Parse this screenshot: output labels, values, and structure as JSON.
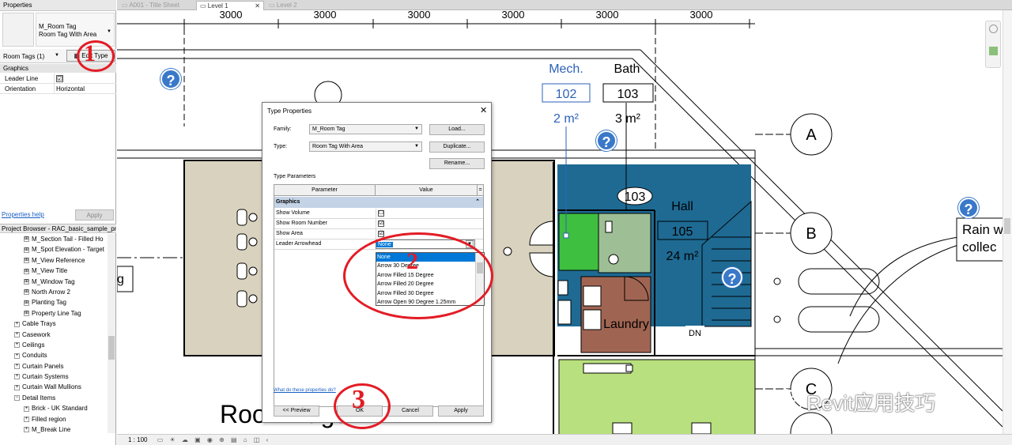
{
  "properties_palette": {
    "title": "Properties",
    "type_family": "M_Room Tag",
    "type_name": "Room Tag With Area",
    "instance_selector": "Room Tags (1)",
    "edit_type_label": "Edit Type",
    "group_graphics": "Graphics",
    "rows": [
      {
        "label": "Leader Line",
        "value": "☑"
      },
      {
        "label": "Orientation",
        "value": "Horizontal"
      }
    ],
    "help_link": "Properties help",
    "apply_label": "Apply"
  },
  "project_browser": {
    "title": "Project Browser - RAC_basic_sample_project.rvt",
    "items": [
      {
        "label": "M_Section Tail - Filled Ho",
        "level": 2,
        "expander": "⊞"
      },
      {
        "label": "M_Spot Elevation - Target",
        "level": 2,
        "expander": "⊞"
      },
      {
        "label": "M_View Reference",
        "level": 2,
        "expander": "⊞"
      },
      {
        "label": "M_View Title",
        "level": 2,
        "expander": "⊞"
      },
      {
        "label": "M_Window Tag",
        "level": 2,
        "expander": "⊞"
      },
      {
        "label": "North Arrow 2",
        "level": 2,
        "expander": "⊞"
      },
      {
        "label": "Planting Tag",
        "level": 2,
        "expander": "⊞"
      },
      {
        "label": "Property Line Tag",
        "level": 2,
        "expander": "⊞"
      },
      {
        "label": "Cable Trays",
        "level": 1,
        "expander": "+"
      },
      {
        "label": "Casework",
        "level": 1,
        "expander": "+"
      },
      {
        "label": "Ceilings",
        "level": 1,
        "expander": "+"
      },
      {
        "label": "Conduits",
        "level": 1,
        "expander": "+"
      },
      {
        "label": "Curtain Panels",
        "level": 1,
        "expander": "+"
      },
      {
        "label": "Curtain Systems",
        "level": 1,
        "expander": "+"
      },
      {
        "label": "Curtain Wall Mullions",
        "level": 1,
        "expander": "+"
      },
      {
        "label": "Detail Items",
        "level": 1,
        "expander": "−"
      },
      {
        "label": "Brick - UK Standard",
        "level": 2,
        "expander": "+"
      },
      {
        "label": "Filled region",
        "level": 2,
        "expander": "+"
      },
      {
        "label": "M_Break Line",
        "level": 2,
        "expander": "+"
      }
    ]
  },
  "tabs": [
    {
      "label": "A001 - Title Sheet",
      "active": false
    },
    {
      "label": "Level 1",
      "active": true
    },
    {
      "label": "Level 2",
      "active": false
    }
  ],
  "canvas": {
    "dimensions": [
      "3000",
      "3000",
      "3000",
      "3000",
      "3000",
      "3000"
    ],
    "rooms": {
      "mech_name": "Mech.",
      "mech_number": "102",
      "mech_area": "2 m²",
      "bath_name": "Bath",
      "bath_number": "103",
      "bath_area": "3 m²",
      "tag_103": "103",
      "hall_name": "Hall",
      "hall_number": "105",
      "hall_area": "24 m²",
      "laundry_name": "Laundry",
      "dn_label": "DN"
    },
    "grids": [
      "A",
      "B",
      "C"
    ],
    "text_rain": "Rain w\ncollec",
    "text_g": "g",
    "text_room_tags": "Room Tags",
    "scale": "1 : 100"
  },
  "dialog": {
    "title": "Type Properties",
    "family_label": "Family:",
    "family_value": "M_Room Tag",
    "type_label": "Type:",
    "type_value": "Room Tag With Area",
    "load_label": "Load...",
    "duplicate_label": "Duplicate...",
    "rename_label": "Rename...",
    "type_params_label": "Type Parameters",
    "col_parameter": "Parameter",
    "col_value": "Value",
    "group_graphics": "Graphics",
    "params": [
      {
        "label": "Show Volume",
        "value": "☐"
      },
      {
        "label": "Show Room Number",
        "value": "☑"
      },
      {
        "label": "Show Area",
        "value": "☑"
      },
      {
        "label": "Leader Arrowhead",
        "value": "None"
      }
    ],
    "dropdown_options": [
      "None",
      "Arrow 30 Degree",
      "Arrow Filled 15 Degree",
      "Arrow Filled 20 Degree",
      "Arrow Filled 30 Degree",
      "Arrow Open 90 Degree 1.25mm"
    ],
    "selected_option": "None",
    "help_link": "What do these properties do?",
    "preview_label": "<< Preview",
    "ok_label": "OK",
    "cancel_label": "Cancel",
    "apply_label": "Apply"
  },
  "annotations": {
    "step1": "1",
    "step2": "2",
    "step3": "3",
    "help_glyph": "?"
  },
  "watermark": "Revit应用技巧",
  "colors": {
    "annotation_red": "#e31c25",
    "help_blue": "#3a78c9",
    "hall_blue": "#1e6a93",
    "green": "#3fbf3f",
    "sage": "#9ebf95",
    "laundry": "#a06552",
    "beige": "#d9d2bf",
    "lawn": "#b8e07e"
  }
}
